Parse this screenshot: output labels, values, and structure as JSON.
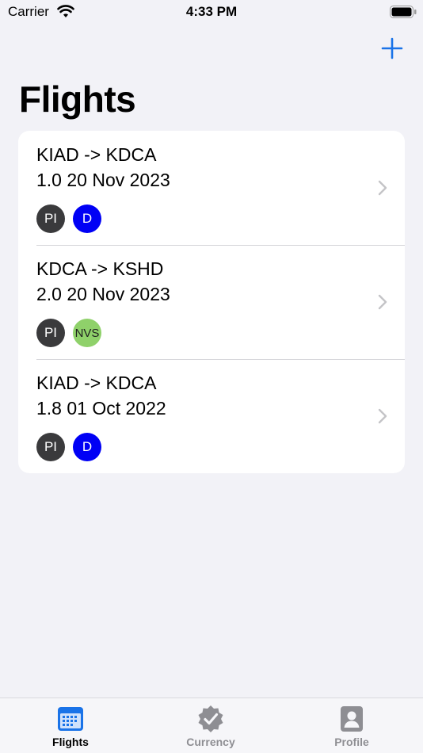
{
  "status_bar": {
    "carrier": "Carrier",
    "time": "4:33 PM"
  },
  "nav": {
    "title": "Flights",
    "accent": "#1a73e8"
  },
  "flights": [
    {
      "route": "KIAD -> KDCA",
      "details": "1.0  20 Nov 2023",
      "tags": [
        {
          "label": "PI",
          "bg": "#3a3a3c",
          "fg": "#ffffff"
        },
        {
          "label": "D",
          "bg": "#0000f5",
          "fg": "#ffffff"
        }
      ]
    },
    {
      "route": "KDCA -> KSHD",
      "details": "2.0  20 Nov 2023",
      "tags": [
        {
          "label": "PI",
          "bg": "#3a3a3c",
          "fg": "#ffffff"
        },
        {
          "label": "NVS",
          "bg": "#8fd16a",
          "fg": "#1e1e1e"
        }
      ]
    },
    {
      "route": "KIAD -> KDCA",
      "details": "1.8  01 Oct 2022",
      "tags": [
        {
          "label": "PI",
          "bg": "#3a3a3c",
          "fg": "#ffffff"
        },
        {
          "label": "D",
          "bg": "#0000f5",
          "fg": "#ffffff"
        }
      ]
    }
  ],
  "tabs": [
    {
      "label": "Flights",
      "icon": "calendar-icon",
      "active": true
    },
    {
      "label": "Currency",
      "icon": "checkmark-seal-icon",
      "active": false
    },
    {
      "label": "Profile",
      "icon": "person-icon",
      "active": false
    }
  ]
}
